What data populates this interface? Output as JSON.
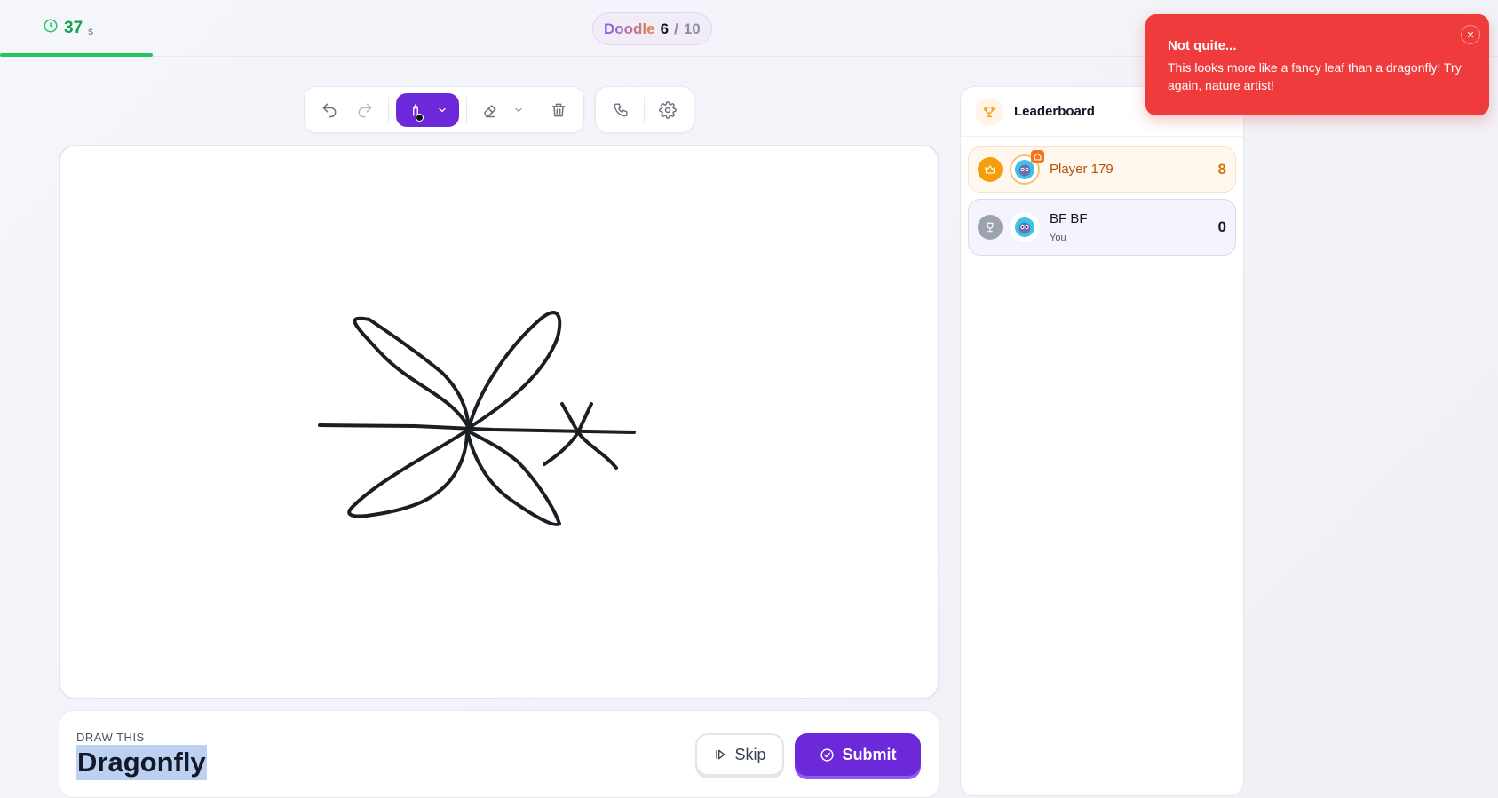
{
  "timer": {
    "value": "37",
    "unit": "s",
    "icon": "clock-icon"
  },
  "round": {
    "word": "Doodle",
    "current": "6",
    "separator": "/",
    "total": "10"
  },
  "toolbar": {
    "undo": "undo-icon",
    "redo": "redo-icon",
    "pen": "pen-icon",
    "eraser": "eraser-icon",
    "clear": "trash-icon",
    "call": "phone-icon",
    "settings": "gear-icon",
    "pen_color": "#111111"
  },
  "prompt": {
    "label": "DRAW THIS",
    "word": "Dragonfly"
  },
  "actions": {
    "skip_label": "Skip",
    "submit_label": "Submit"
  },
  "leaderboard": {
    "title": "Leaderboard",
    "players": [
      {
        "name": "Player 179",
        "score": "8",
        "rank_icon": "crown-icon",
        "host": true
      },
      {
        "name": "BF BF",
        "subtitle": "You",
        "score": "0",
        "rank_icon": "trophy-icon"
      }
    ]
  },
  "toast": {
    "title": "Not quite...",
    "message": "This looks more like a fancy leaf than a dragonfly! Try again, nature artist!"
  },
  "colors": {
    "accent": "#6d28d9",
    "timer": "#22c55e",
    "toast": "#ef3b3b",
    "gold": "#f59e0b"
  }
}
